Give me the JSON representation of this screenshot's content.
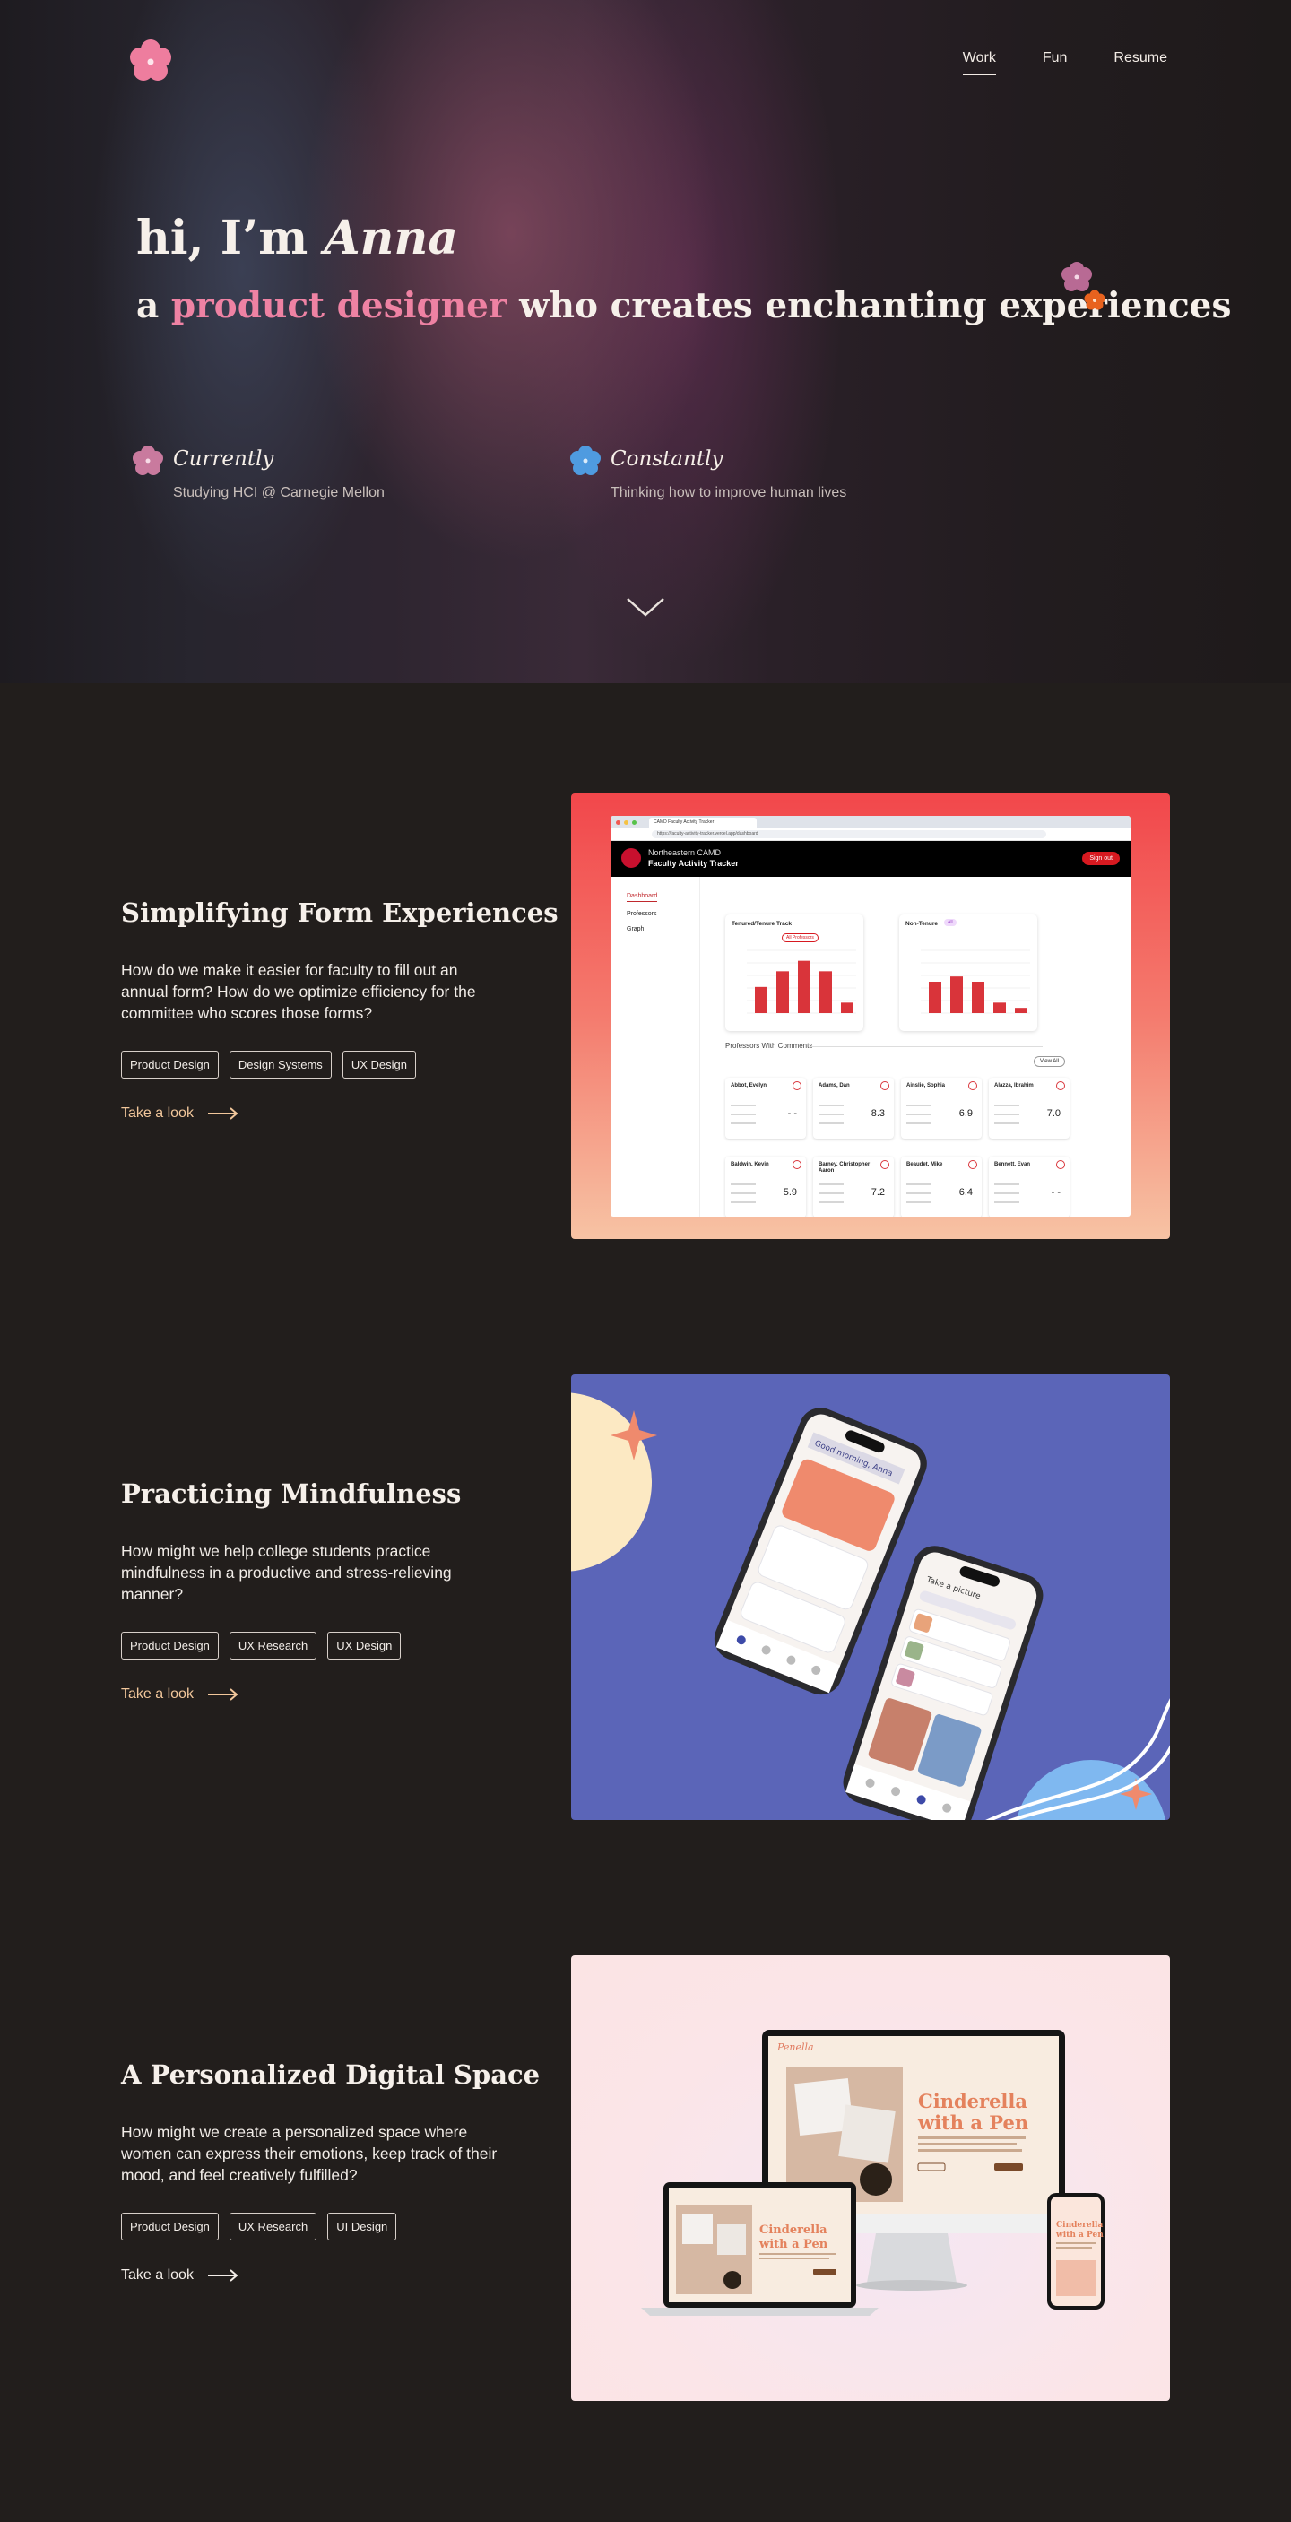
{
  "nav": {
    "items": [
      {
        "label": "Work",
        "active": true
      },
      {
        "label": "Fun",
        "active": false
      },
      {
        "label": "Resume",
        "active": false
      }
    ]
  },
  "hero": {
    "greeting_prefix": "hi, I’m ",
    "greeting_name": "Anna",
    "tagline_before": "a ",
    "tagline_accent": "product designer",
    "tagline_after": " who creates enchanting experiences",
    "accent_color": "#ee82a3",
    "status": [
      {
        "label": "Currently",
        "desc": "Studying HCI @ Carnegie Mellon",
        "icon": "pink-flower-icon"
      },
      {
        "label": "Constantly",
        "desc": "Thinking how to improve human lives",
        "icon": "blue-flower-icon"
      }
    ]
  },
  "projects": [
    {
      "title": "Simplifying Form Experiences",
      "desc": "How do we make it easier for faculty to fill out an annual form? How do we optimize efficiency for the committee who scores those forms?",
      "tags": [
        "Product Design",
        "Design Systems",
        "UX Design"
      ],
      "cta": "Take a look",
      "cta_color": "#f2c79b",
      "mock": {
        "url": "https://faculty-activity-tracker.vercel.app/dashboard",
        "tab": "CAMD Faculty Activity Tracker",
        "org": "Northeastern CAMD",
        "app": "Faculty Activity Tracker",
        "signout": "Sign out",
        "sidebar": [
          "Dashboard",
          "Professors",
          "Graph"
        ],
        "chart1_title": "Tenured/Tenure Track",
        "chart1_badge": "All Professors",
        "chart2_title": "Non-Tenure",
        "chart2_badge": "All",
        "chart1_values": [
          5,
          8,
          10,
          8,
          2
        ],
        "chart2_values": [
          6,
          7,
          6,
          2,
          1
        ],
        "comments_title": "Professors With Comments",
        "view_all": "View All",
        "cards": [
          {
            "name": "Abbot, Evelyn",
            "score": "- -"
          },
          {
            "name": "Adams, Dan",
            "score": "8.3"
          },
          {
            "name": "Ainslie, Sophia",
            "score": "6.9"
          },
          {
            "name": "Alazza, Ibrahim",
            "score": "7.0"
          },
          {
            "name": "Baldwin, Kevin",
            "score": "5.9"
          },
          {
            "name": "Barney, Christopher Aaron",
            "score": "7.2"
          },
          {
            "name": "Beaudet, Mike",
            "score": "6.4"
          },
          {
            "name": "Bennett, Evan",
            "score": "- -"
          }
        ]
      }
    },
    {
      "title": "Practicing Mindfulness",
      "desc": "How might we help college students practice mindfulness in a productive and stress-relieving manner?",
      "tags": [
        "Product Design",
        "UX Research",
        "UX Design"
      ],
      "cta": "Take a look",
      "cta_color": "#f2c79b",
      "mock": {
        "greeting": "Good morning, Anna",
        "screen2_title": "Take a picture"
      }
    },
    {
      "title": "A Personalized Digital Space",
      "desc": "How might we create a personalized space where women can express their emotions, keep track of their mood, and feel creatively fulfilled?",
      "tags": [
        "Product Design",
        "UX Research",
        "UI Design"
      ],
      "cta": "Take a look",
      "cta_color": "#f3ede8",
      "mock": {
        "brand": "Penella",
        "headline_line1": "Cinderella",
        "headline_line2": "with a Pen"
      }
    }
  ]
}
